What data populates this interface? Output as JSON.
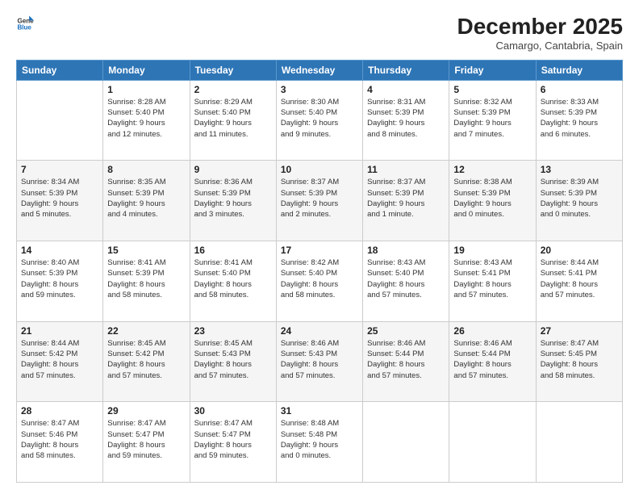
{
  "logo": {
    "line1": "General",
    "line2": "Blue"
  },
  "header": {
    "title": "December 2025",
    "subtitle": "Camargo, Cantabria, Spain"
  },
  "days_of_week": [
    "Sunday",
    "Monday",
    "Tuesday",
    "Wednesday",
    "Thursday",
    "Friday",
    "Saturday"
  ],
  "weeks": [
    [
      {
        "num": "",
        "info": ""
      },
      {
        "num": "1",
        "info": "Sunrise: 8:28 AM\nSunset: 5:40 PM\nDaylight: 9 hours\nand 12 minutes."
      },
      {
        "num": "2",
        "info": "Sunrise: 8:29 AM\nSunset: 5:40 PM\nDaylight: 9 hours\nand 11 minutes."
      },
      {
        "num": "3",
        "info": "Sunrise: 8:30 AM\nSunset: 5:40 PM\nDaylight: 9 hours\nand 9 minutes."
      },
      {
        "num": "4",
        "info": "Sunrise: 8:31 AM\nSunset: 5:39 PM\nDaylight: 9 hours\nand 8 minutes."
      },
      {
        "num": "5",
        "info": "Sunrise: 8:32 AM\nSunset: 5:39 PM\nDaylight: 9 hours\nand 7 minutes."
      },
      {
        "num": "6",
        "info": "Sunrise: 8:33 AM\nSunset: 5:39 PM\nDaylight: 9 hours\nand 6 minutes."
      }
    ],
    [
      {
        "num": "7",
        "info": "Sunrise: 8:34 AM\nSunset: 5:39 PM\nDaylight: 9 hours\nand 5 minutes."
      },
      {
        "num": "8",
        "info": "Sunrise: 8:35 AM\nSunset: 5:39 PM\nDaylight: 9 hours\nand 4 minutes."
      },
      {
        "num": "9",
        "info": "Sunrise: 8:36 AM\nSunset: 5:39 PM\nDaylight: 9 hours\nand 3 minutes."
      },
      {
        "num": "10",
        "info": "Sunrise: 8:37 AM\nSunset: 5:39 PM\nDaylight: 9 hours\nand 2 minutes."
      },
      {
        "num": "11",
        "info": "Sunrise: 8:37 AM\nSunset: 5:39 PM\nDaylight: 9 hours\nand 1 minute."
      },
      {
        "num": "12",
        "info": "Sunrise: 8:38 AM\nSunset: 5:39 PM\nDaylight: 9 hours\nand 0 minutes."
      },
      {
        "num": "13",
        "info": "Sunrise: 8:39 AM\nSunset: 5:39 PM\nDaylight: 9 hours\nand 0 minutes."
      }
    ],
    [
      {
        "num": "14",
        "info": "Sunrise: 8:40 AM\nSunset: 5:39 PM\nDaylight: 8 hours\nand 59 minutes."
      },
      {
        "num": "15",
        "info": "Sunrise: 8:41 AM\nSunset: 5:39 PM\nDaylight: 8 hours\nand 58 minutes."
      },
      {
        "num": "16",
        "info": "Sunrise: 8:41 AM\nSunset: 5:40 PM\nDaylight: 8 hours\nand 58 minutes."
      },
      {
        "num": "17",
        "info": "Sunrise: 8:42 AM\nSunset: 5:40 PM\nDaylight: 8 hours\nand 58 minutes."
      },
      {
        "num": "18",
        "info": "Sunrise: 8:43 AM\nSunset: 5:40 PM\nDaylight: 8 hours\nand 57 minutes."
      },
      {
        "num": "19",
        "info": "Sunrise: 8:43 AM\nSunset: 5:41 PM\nDaylight: 8 hours\nand 57 minutes."
      },
      {
        "num": "20",
        "info": "Sunrise: 8:44 AM\nSunset: 5:41 PM\nDaylight: 8 hours\nand 57 minutes."
      }
    ],
    [
      {
        "num": "21",
        "info": "Sunrise: 8:44 AM\nSunset: 5:42 PM\nDaylight: 8 hours\nand 57 minutes."
      },
      {
        "num": "22",
        "info": "Sunrise: 8:45 AM\nSunset: 5:42 PM\nDaylight: 8 hours\nand 57 minutes."
      },
      {
        "num": "23",
        "info": "Sunrise: 8:45 AM\nSunset: 5:43 PM\nDaylight: 8 hours\nand 57 minutes."
      },
      {
        "num": "24",
        "info": "Sunrise: 8:46 AM\nSunset: 5:43 PM\nDaylight: 8 hours\nand 57 minutes."
      },
      {
        "num": "25",
        "info": "Sunrise: 8:46 AM\nSunset: 5:44 PM\nDaylight: 8 hours\nand 57 minutes."
      },
      {
        "num": "26",
        "info": "Sunrise: 8:46 AM\nSunset: 5:44 PM\nDaylight: 8 hours\nand 57 minutes."
      },
      {
        "num": "27",
        "info": "Sunrise: 8:47 AM\nSunset: 5:45 PM\nDaylight: 8 hours\nand 58 minutes."
      }
    ],
    [
      {
        "num": "28",
        "info": "Sunrise: 8:47 AM\nSunset: 5:46 PM\nDaylight: 8 hours\nand 58 minutes."
      },
      {
        "num": "29",
        "info": "Sunrise: 8:47 AM\nSunset: 5:47 PM\nDaylight: 8 hours\nand 59 minutes."
      },
      {
        "num": "30",
        "info": "Sunrise: 8:47 AM\nSunset: 5:47 PM\nDaylight: 8 hours\nand 59 minutes."
      },
      {
        "num": "31",
        "info": "Sunrise: 8:48 AM\nSunset: 5:48 PM\nDaylight: 9 hours\nand 0 minutes."
      },
      {
        "num": "",
        "info": ""
      },
      {
        "num": "",
        "info": ""
      },
      {
        "num": "",
        "info": ""
      }
    ]
  ]
}
